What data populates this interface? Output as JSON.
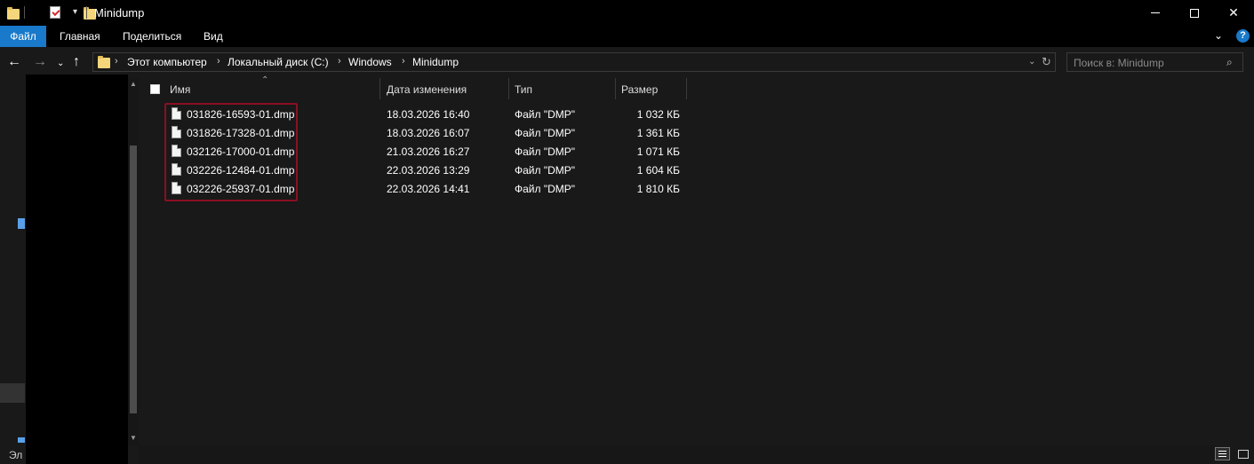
{
  "window": {
    "title": "Minidump"
  },
  "ribbon": {
    "tabs": [
      "Файл",
      "Главная",
      "Поделиться",
      "Вид"
    ]
  },
  "navigation": {
    "breadcrumb": [
      "Этот компьютер",
      "Локальный диск (C:)",
      "Windows",
      "Minidump"
    ],
    "search_placeholder": "Поиск в: Minidump"
  },
  "columns": {
    "name": "Имя",
    "date": "Дата изменения",
    "type": "Тип",
    "size": "Размер"
  },
  "files": [
    {
      "name": "031826-16593-01.dmp",
      "date": "18.03.2026 16:40",
      "type": "Файл \"DMP\"",
      "size": "1 032 КБ"
    },
    {
      "name": "031826-17328-01.dmp",
      "date": "18.03.2026 16:07",
      "type": "Файл \"DMP\"",
      "size": "1 361 КБ"
    },
    {
      "name": "032126-17000-01.dmp",
      "date": "21.03.2026 16:27",
      "type": "Файл \"DMP\"",
      "size": "1 071 КБ"
    },
    {
      "name": "032226-12484-01.dmp",
      "date": "22.03.2026 13:29",
      "type": "Файл \"DMP\"",
      "size": "1 604 КБ"
    },
    {
      "name": "032226-25937-01.dmp",
      "date": "22.03.2026 14:41",
      "type": "Файл \"DMP\"",
      "size": "1 810 КБ"
    }
  ],
  "status": {
    "text": "Эл"
  },
  "colors": {
    "accent": "#1979ca",
    "highlight_border": "#8b0f23",
    "background": "#191919"
  }
}
